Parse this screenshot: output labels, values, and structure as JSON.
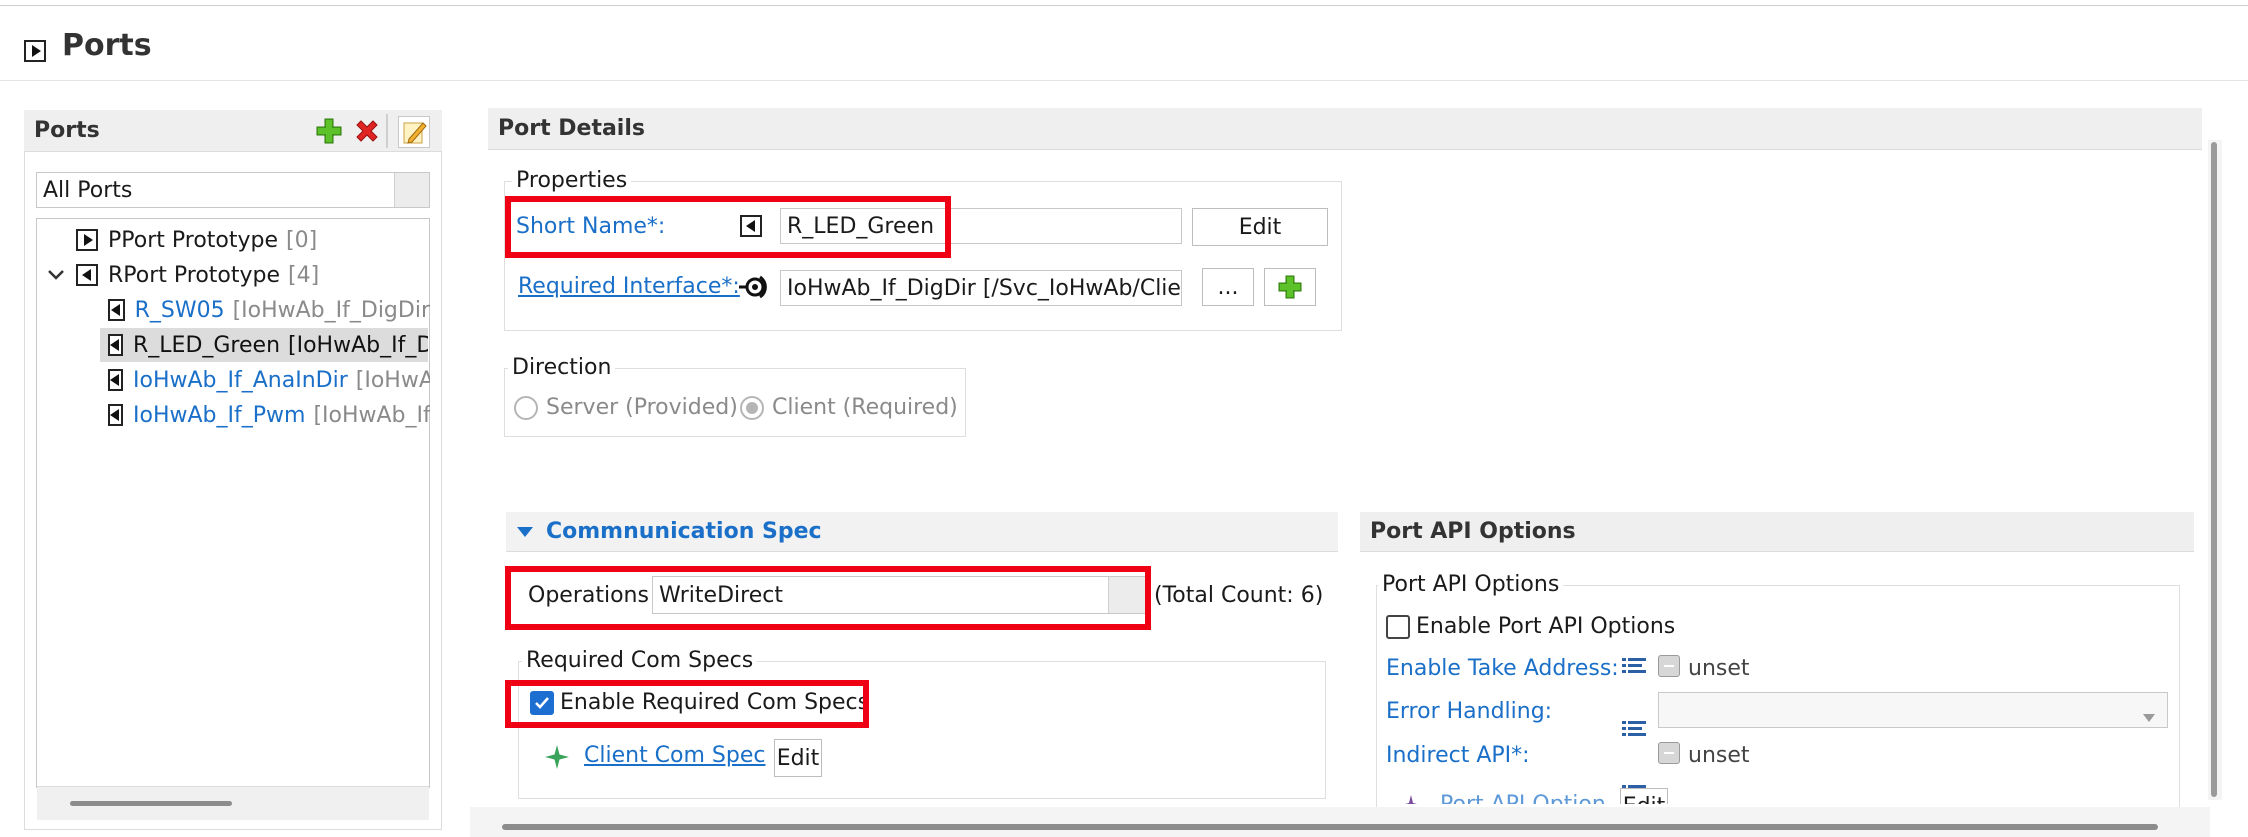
{
  "page": {
    "title": "Ports"
  },
  "left_panel": {
    "title": "Ports",
    "filter_value": "All Ports",
    "tree": [
      {
        "label": "PPort Prototype",
        "count": "[0]"
      },
      {
        "label": "RPort Prototype",
        "count": "[4]"
      }
    ],
    "rports": [
      {
        "name": "R_SW05",
        "detail": "[IoHwAb_If_DigDir"
      },
      {
        "name": "R_LED_Green",
        "detail": "[IoHwAb_If_D"
      },
      {
        "name": "IoHwAb_If_AnaInDir",
        "detail": "[IoHwA"
      },
      {
        "name": "IoHwAb_If_Pwm",
        "detail": "[IoHwAb_If"
      }
    ]
  },
  "port_details": {
    "title": "Port Details",
    "properties": {
      "group_label": "Properties",
      "short_name_label": "Short Name*:",
      "short_name_value": "R_LED_Green",
      "edit_label": "Edit",
      "required_interface_label": "Required Interface*:",
      "required_interface_value": "IoHwAb_If_DigDir [/Svc_IoHwAb/Clier",
      "browse_label": "..."
    },
    "direction": {
      "group_label": "Direction",
      "server_label": "Server (Provided)",
      "client_label": "Client (Required)"
    }
  },
  "comm_spec": {
    "title": "Commnunication Spec",
    "operations_label": "Operations",
    "operations_value": "WriteDirect",
    "total_count": "(Total Count: 6)",
    "required_group_label": "Required Com Specs",
    "enable_required_label": "Enable Required Com Specs",
    "client_com_spec_label": "Client Com Spec",
    "edit_label": "Edit"
  },
  "port_api": {
    "title": "Port API Options",
    "group_label": "Port API Options",
    "enable_label": "Enable Port API Options",
    "take_address_label": "Enable Take Address:",
    "take_address_value": "unset",
    "error_handling_label": "Error Handling:",
    "indirect_api_label": "Indirect API*:",
    "indirect_api_value": "unset",
    "port_api_option_label": "Port API Option",
    "edit_label": "Edit"
  },
  "colors": {
    "link": "#1a6fc8",
    "highlight": "#f00014",
    "accent": "#1c6fd1",
    "plus": "#4caf1c",
    "delete": "#e02424"
  }
}
